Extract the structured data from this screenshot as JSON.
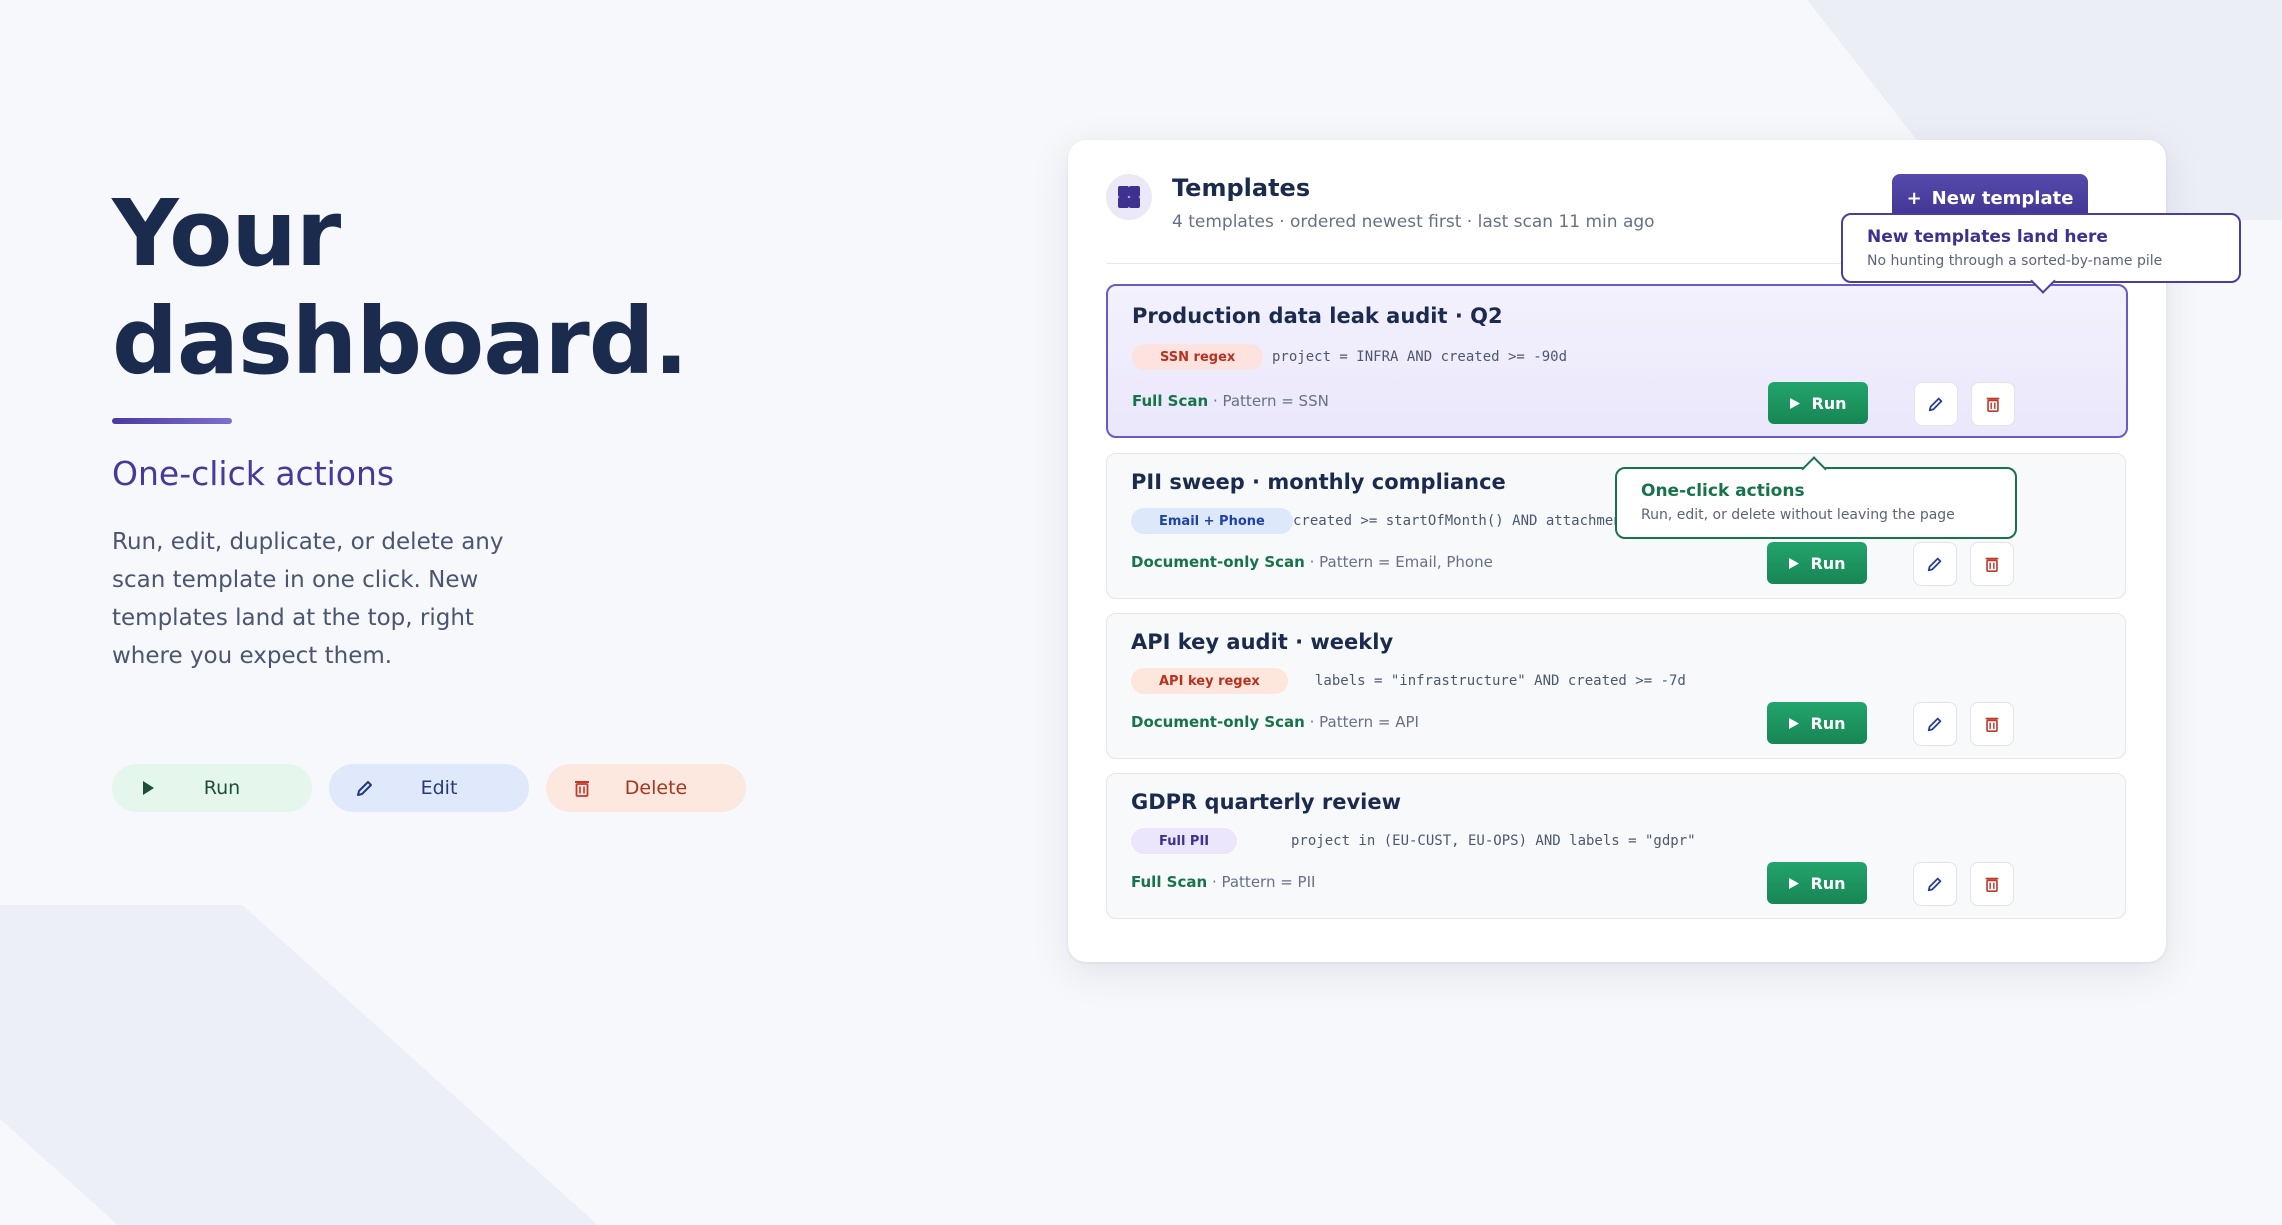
{
  "hero": {
    "title_line1": "Your",
    "title_line2": "dashboard.",
    "subtitle": "One-click actions",
    "description": "Run, edit, duplicate, or delete any scan template in one click. New templates land at the top, right where you expect them."
  },
  "pills": {
    "run_label": "Run",
    "edit_label": "Edit",
    "delete_label": "Delete"
  },
  "card": {
    "title": "Templates",
    "subtitle": "4 templates · ordered newest first · last scan 11 min ago",
    "new_button_icon": "+",
    "new_button_label": "New template"
  },
  "templates": [
    {
      "title": "Production data leak audit · Q2",
      "tag": "SSN regex",
      "query": "project = INFRA AND created >= -90d",
      "scan_type": "Full Scan",
      "pattern": " · Pattern = SSN",
      "run_label": "Run"
    },
    {
      "title": "PII sweep · monthly compliance",
      "tag": "Email + Phone",
      "query": "created >= startOfMonth() AND attachments IS NOT EMPTY",
      "scan_type": "Document-only Scan",
      "pattern": " · Pattern = Email, Phone",
      "run_label": "Run"
    },
    {
      "title": "API key audit · weekly",
      "tag": "API key regex",
      "query": "labels = \"infrastructure\" AND created >= -7d",
      "scan_type": "Document-only Scan",
      "pattern": " · Pattern = API",
      "run_label": "Run"
    },
    {
      "title": "GDPR quarterly review",
      "tag": "Full PII",
      "query": "project in (EU-CUST, EU-OPS) AND labels = \"gdpr\"",
      "scan_type": "Full Scan",
      "pattern": " · Pattern = PII",
      "run_label": "Run"
    }
  ],
  "callouts": {
    "new_templates_title": "New templates land here",
    "new_templates_text": "No hunting through a sorted-by-name pile",
    "one_click_title": "One-click actions",
    "one_click_text": "Run, edit, or delete without leaving the page"
  },
  "colors": {
    "accent_purple": "#40328f",
    "run_green": "#178654",
    "delete_red": "#c0392b",
    "tag_ssn_bg": "#fde3e0",
    "tag_email_bg": "#dde8fb",
    "tag_api_bg": "#fde6dc",
    "tag_pii_bg": "#ebe6fb"
  },
  "icons": {
    "run": "play-icon",
    "edit": "pencil-icon",
    "delete": "trash-icon",
    "header": "grid-icon"
  }
}
